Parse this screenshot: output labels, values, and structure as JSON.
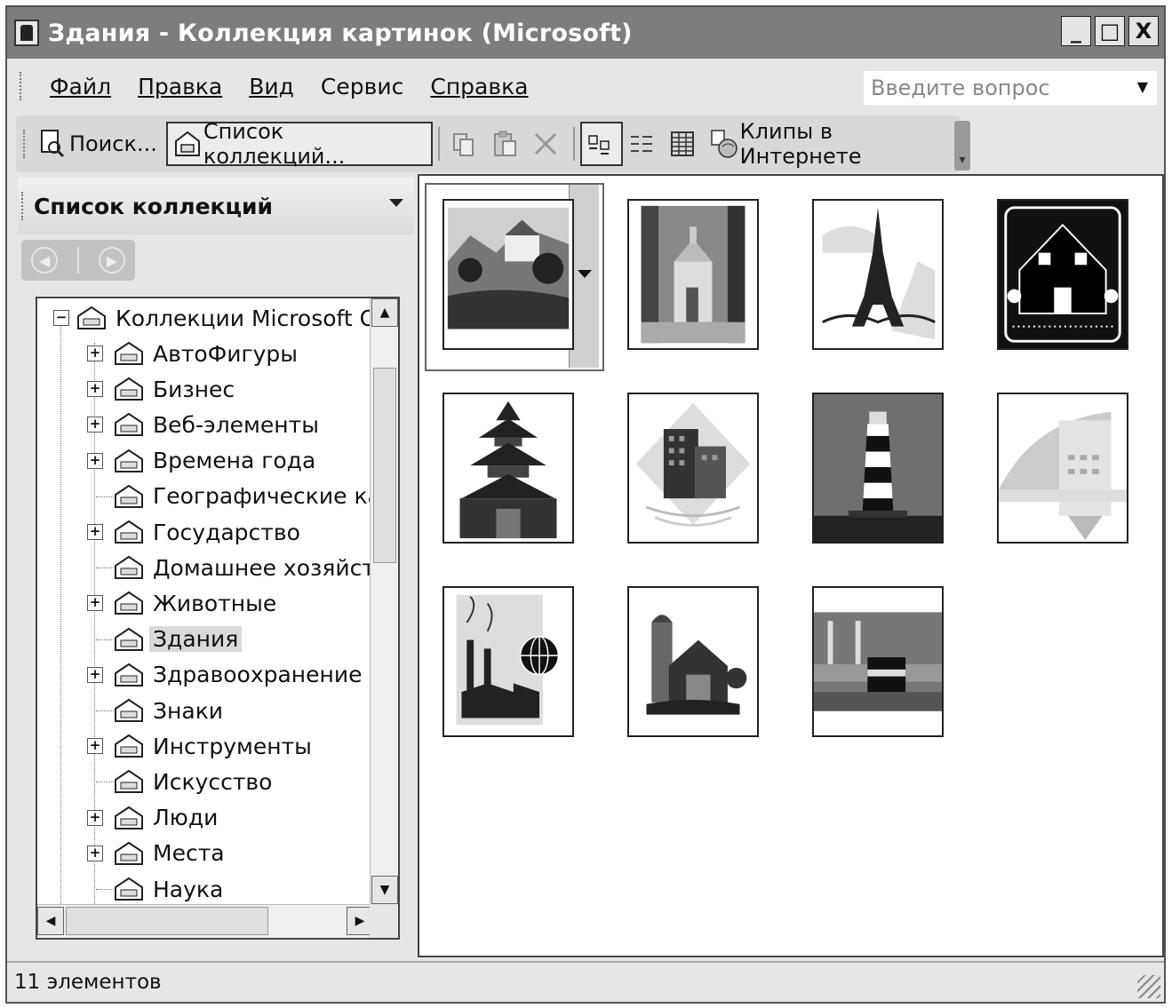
{
  "window": {
    "title": "Здания - Коллекция картинок (Microsoft)",
    "controls": {
      "minimize": "_",
      "maximize": "□",
      "close": "X"
    }
  },
  "menu": {
    "items": [
      {
        "label": "Файл",
        "mnemonic": "Ф"
      },
      {
        "label": "Правка",
        "mnemonic": "П"
      },
      {
        "label": "Вид",
        "mnemonic": "В"
      },
      {
        "label": "Сервис",
        "mnemonic": "р"
      },
      {
        "label": "Справка",
        "mnemonic": "С"
      }
    ],
    "help_placeholder": "Введите вопрос"
  },
  "toolbar": {
    "search_label": "Поиск...",
    "collections_label": "Список коллекций...",
    "online_label": "Клипы в Интернете"
  },
  "taskpane": {
    "title": "Список коллекций",
    "tree": {
      "root": "Коллекции Microsoft Offic",
      "items": [
        {
          "label": "АвтоФигуры",
          "expandable": true
        },
        {
          "label": "Бизнес",
          "expandable": true
        },
        {
          "label": "Веб-элементы",
          "expandable": true
        },
        {
          "label": "Времена года",
          "expandable": true
        },
        {
          "label": "Географические карт",
          "expandable": false
        },
        {
          "label": "Государство",
          "expandable": true
        },
        {
          "label": "Домашнее хозяйство",
          "expandable": false
        },
        {
          "label": "Животные",
          "expandable": true
        },
        {
          "label": "Здания",
          "expandable": false,
          "selected": true
        },
        {
          "label": "Здравоохранение",
          "expandable": true
        },
        {
          "label": "Знаки",
          "expandable": false
        },
        {
          "label": "Инструменты",
          "expandable": true
        },
        {
          "label": "Искусство",
          "expandable": false
        },
        {
          "label": "Люди",
          "expandable": true
        },
        {
          "label": "Места",
          "expandable": true
        },
        {
          "label": "Наука",
          "expandable": false
        }
      ]
    }
  },
  "gallery": {
    "clips": [
      {
        "name": "landscape-castle",
        "selected": true
      },
      {
        "name": "forest-church"
      },
      {
        "name": "eiffel-tower"
      },
      {
        "name": "house-sign"
      },
      {
        "name": "pagoda"
      },
      {
        "name": "office-building"
      },
      {
        "name": "lighthouse"
      },
      {
        "name": "abstract-building"
      },
      {
        "name": "factory-globe"
      },
      {
        "name": "barn-silo"
      },
      {
        "name": "kaaba-mosque"
      }
    ]
  },
  "status": {
    "text": "11 элементов"
  }
}
